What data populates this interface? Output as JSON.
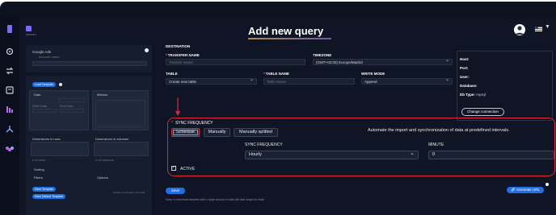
{
  "page": {
    "title": "Add new query"
  },
  "left_panel": {
    "brand": "DIDSOFT",
    "source_name": "Google Ads",
    "source_account": "Account name",
    "load_template": "Load Template",
    "date_label": "Date",
    "metrics_label": "Metrics",
    "start_date": "Start Date",
    "end_date": "End Date",
    "start_value": "2023-05-01",
    "end_value": "2023-05-31",
    "dimensions_rows": "Dimensions in rows",
    "dimensions_columns": "Dimensions in columns",
    "rows_count": "# of rows",
    "cols_count": "# of columns",
    "sorting": "Sorting",
    "filters": "Filters",
    "options": "Options",
    "save_template": "Save Template",
    "save_default_template": "Save Default Template",
    "use_combination": "Enable combination with data"
  },
  "destination": {
    "heading": "DESTINATION",
    "transfer_name_label": "TRANSFER NAME",
    "transfer_name_placeholder": "Transfer Name",
    "timezone_label": "TIMEZONE",
    "timezone_value": "(GMT+02:00) Europe/Madrid",
    "table_label": "TABLE",
    "table_value": "Create new table",
    "table_name_label": "TABLE NAME",
    "table_name_placeholder": "Table Name",
    "write_mode_label": "WRITE MODE",
    "write_mode_value": "Append"
  },
  "connection": {
    "host_label": "Host:",
    "port_label": "Port:",
    "user_label": "User:",
    "database_label": "Database:",
    "db_type_label": "Db Type:",
    "db_type_value": "mysql",
    "change_button": "Change connection"
  },
  "sync": {
    "section_label": "SYNC FREQUENCY",
    "options": [
      "Schedule",
      "Manually",
      "Manually splitted"
    ],
    "selected": "Schedule",
    "description": "Automate the import and synchronization of data at predefined intervals.",
    "frequency_label": "SYNC FREQUENCY",
    "frequency_value": "Hourly",
    "minute_label": "MINUTE",
    "minute_value": "0",
    "active_label": "ACTIVE",
    "active_checked": true
  },
  "footer": {
    "save_button": "Save",
    "note": "Keep in mind that transfers with a large amount of data will take longer to finish",
    "generate_url_button": "Generate URL"
  },
  "colors": {
    "accent": "#1f6fe5",
    "highlight": "#d8283a",
    "background": "#0f1524"
  },
  "icons": {
    "sidebar": [
      "logo-icon",
      "settings-icon",
      "transfer-icon",
      "database-icon",
      "chart-icon",
      "flow-icon",
      "community-icon"
    ]
  }
}
